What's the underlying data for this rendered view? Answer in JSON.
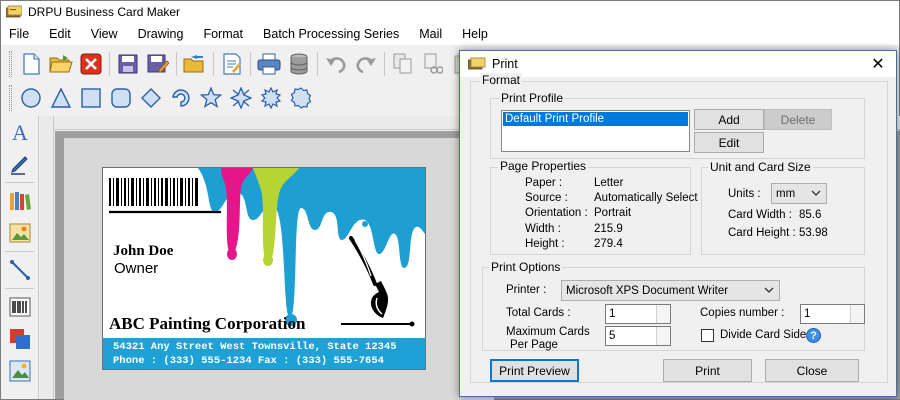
{
  "app": {
    "title": "DRPU Business Card Maker"
  },
  "menu": [
    "File",
    "Edit",
    "View",
    "Drawing",
    "Format",
    "Batch Processing Series",
    "Mail",
    "Help"
  ],
  "card": {
    "name": "John Doe",
    "role": "Owner",
    "company": "ABC Painting Corporation",
    "address": "54321 Any Street West Townsville, State 12345",
    "contact": "Phone : (333) 555-1234 Fax : (333) 555-7654"
  },
  "dialog": {
    "title": "Print",
    "format_label": "Format",
    "print_profile": {
      "label": "Print Profile",
      "items": [
        "Default Print Profile"
      ],
      "add": "Add",
      "delete": "Delete",
      "edit": "Edit"
    },
    "page_properties": {
      "label": "Page Properties",
      "rows": [
        {
          "key": "Paper :",
          "value": "Letter"
        },
        {
          "key": "Source :",
          "value": "Automatically Select"
        },
        {
          "key": "Orientation :",
          "value": "Portrait"
        },
        {
          "key": "Width :",
          "value": "215.9"
        },
        {
          "key": "Height :",
          "value": "279.4"
        }
      ]
    },
    "unit_card": {
      "label": "Unit and Card Size",
      "units_label": "Units :",
      "units_value": "mm",
      "width_label": "Card Width :",
      "width_value": "85.6",
      "height_label": "Card Height :",
      "height_value": "53.98"
    },
    "print_options": {
      "label": "Print Options",
      "printer_label": "Printer :",
      "printer_value": "Microsoft XPS Document Writer",
      "total_cards_label": "Total Cards :",
      "total_cards_value": "1",
      "copies_label": "Copies number :",
      "copies_value": "1",
      "max_cards_label_1": "Maximum Cards",
      "max_cards_label_2": "Per Page",
      "max_cards_value": "5",
      "divide_label": "Divide Card Side",
      "help": "?"
    },
    "buttons": {
      "preview": "Print Preview",
      "print": "Print",
      "close": "Close"
    }
  },
  "colors": {
    "accent": "#0078d7",
    "card_band": "#1da1d6",
    "paint_blue": "#1e9fd4",
    "paint_magenta": "#e6158a",
    "paint_green": "#b7d433"
  }
}
